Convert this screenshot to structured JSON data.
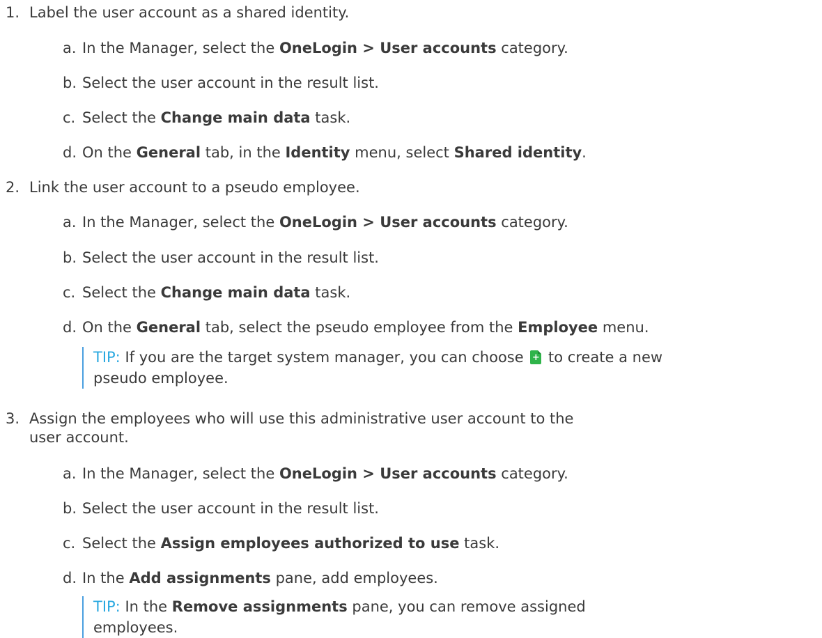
{
  "steps": [
    {
      "num": "1.",
      "text": "Label the user account as a shared identity.",
      "subs": [
        {
          "letter": "a.",
          "parts": [
            "In the Manager, select the ",
            "OneLogin > User accounts",
            " category."
          ]
        },
        {
          "letter": "b.",
          "parts": [
            "Select the user account in the result list."
          ]
        },
        {
          "letter": "c.",
          "parts": [
            "Select the ",
            "Change main data",
            " task."
          ]
        },
        {
          "letter": "d.",
          "parts": [
            "On the ",
            "General",
            " tab, in the ",
            "Identity",
            " menu, select ",
            "Shared identity",
            "."
          ]
        }
      ]
    },
    {
      "num": "2.",
      "text": "Link the user account to a pseudo employee.",
      "subs": [
        {
          "letter": "a.",
          "parts": [
            "In the Manager, select the ",
            "OneLogin > User accounts",
            " category."
          ]
        },
        {
          "letter": "b.",
          "parts": [
            "Select the user account in the result list."
          ]
        },
        {
          "letter": "c.",
          "parts": [
            "Select the ",
            "Change main data",
            " task."
          ]
        },
        {
          "letter": "d.",
          "parts": [
            "On the ",
            "General",
            " tab, select the pseudo employee from the ",
            "Employee",
            " menu."
          ]
        }
      ],
      "tip": {
        "label": "TIP:",
        "line1_before": " If you are the target system manager, you can choose ",
        "line1_after": " to create a new",
        "line2": "pseudo employee."
      }
    },
    {
      "num": "3.",
      "text": "Assign the employees who will use this administrative user account to the",
      "text_cont": "user account.",
      "subs": [
        {
          "letter": "a.",
          "parts": [
            "In the Manager, select the ",
            "OneLogin > User accounts",
            " category."
          ]
        },
        {
          "letter": "b.",
          "parts": [
            "Select the user account in the result list."
          ]
        },
        {
          "letter": "c.",
          "parts": [
            "Select the ",
            "Assign employees authorized to use",
            " task."
          ]
        },
        {
          "letter": "d.",
          "parts": [
            "In the ",
            "Add assignments",
            " pane, add employees."
          ]
        }
      ],
      "tip": {
        "label": "TIP:",
        "line1_before": " In the ",
        "line1_bold": "Remove assignments",
        "line1_after": " pane, you can remove assigned",
        "line2": "employees."
      }
    }
  ],
  "icons": {
    "create": "add-document-icon"
  },
  "colors": {
    "tip": "#29a8e0",
    "text": "#3a3a3a",
    "tip_border": "#4a9fe0"
  }
}
